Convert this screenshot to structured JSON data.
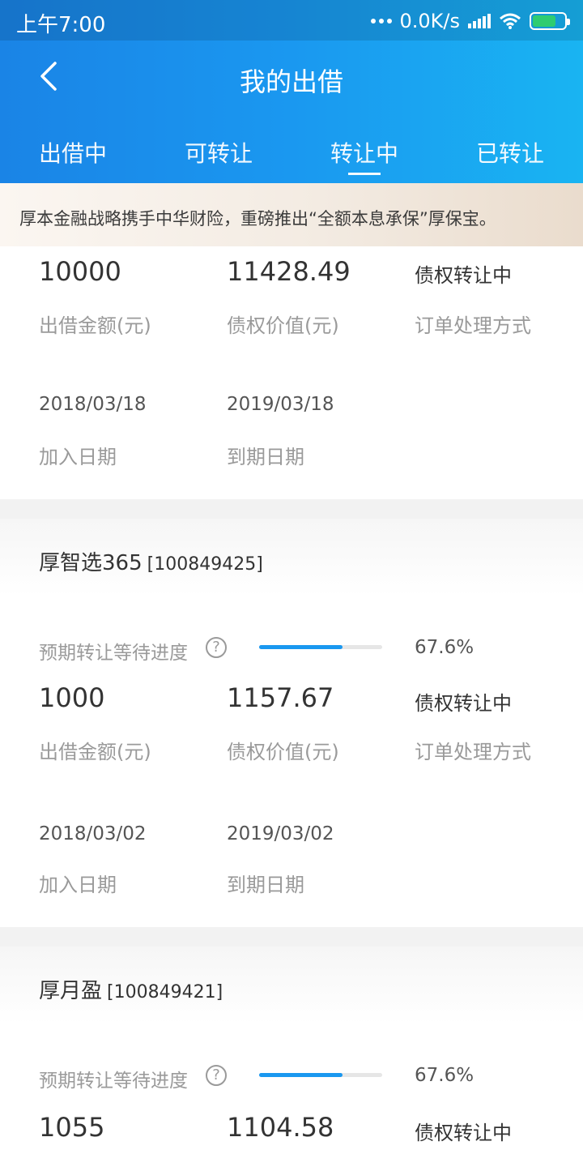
{
  "status_bar": {
    "time": "上午7:00",
    "net_speed": "0.0K/s",
    "icons": [
      "dots-icon",
      "signal-icon",
      "wifi-icon",
      "battery-charging-icon"
    ]
  },
  "header": {
    "title": "我的出借",
    "back_icon": "chevron-left-icon",
    "tabs": [
      {
        "label": "出借中",
        "active": false
      },
      {
        "label": "可转让",
        "active": false
      },
      {
        "label": "转让中",
        "active": true
      },
      {
        "label": "已转让",
        "active": false
      }
    ]
  },
  "notice": "厚本金融战略携手中华财险，重磅推出“全额本息承保”厚保宝。",
  "labels": {
    "amount": "出借金额(元)",
    "value": "债权价值(元)",
    "method": "订单处理方式",
    "join_date": "加入日期",
    "due_date": "到期日期",
    "progress": "预期转让等待进度",
    "help": "?"
  },
  "items": [
    {
      "name": "",
      "code": "",
      "progress_pct": "",
      "progress_fraction": null,
      "amount": "10000",
      "value": "11428.49",
      "status": "债权转让中",
      "join_date": "2018/03/18",
      "due_date": "2019/03/18"
    },
    {
      "name": "厚智选365",
      "code": "[100849425]",
      "progress_pct": "67.6%",
      "progress_fraction": 0.676,
      "amount": "1000",
      "value": "1157.67",
      "status": "债权转让中",
      "join_date": "2018/03/02",
      "due_date": "2019/03/02"
    },
    {
      "name": "厚月盈",
      "code": "[100849421]",
      "progress_pct": "67.6%",
      "progress_fraction": 0.676,
      "amount": "1055",
      "value": "1104.58",
      "status": "债权转让中",
      "join_date": "",
      "due_date": ""
    }
  ],
  "colors": {
    "brand_blue": "#1a98f0",
    "progress_track": "#e6e6e6",
    "muted_text": "#9a9a9a"
  }
}
